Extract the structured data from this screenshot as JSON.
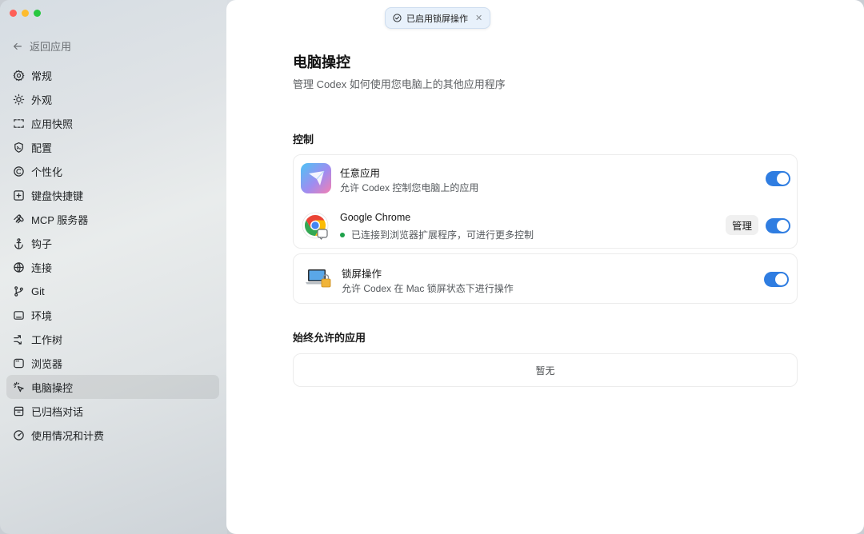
{
  "sidebar": {
    "back_label": "返回应用",
    "items": [
      {
        "label": "常规",
        "icon": "gear-icon"
      },
      {
        "label": "外观",
        "icon": "sun-icon"
      },
      {
        "label": "应用快照",
        "icon": "screenshot-icon"
      },
      {
        "label": "配置",
        "icon": "shield-icon"
      },
      {
        "label": "个性化",
        "icon": "smile-icon"
      },
      {
        "label": "键盘快捷键",
        "icon": "keyboard-icon"
      },
      {
        "label": "MCP 服务器",
        "icon": "mcp-icon"
      },
      {
        "label": "钩子",
        "icon": "anchor-icon"
      },
      {
        "label": "连接",
        "icon": "globe-icon"
      },
      {
        "label": "Git",
        "icon": "git-branch-icon"
      },
      {
        "label": "环境",
        "icon": "monitor-icon"
      },
      {
        "label": "工作树",
        "icon": "worktree-icon"
      },
      {
        "label": "浏览器",
        "icon": "browser-icon"
      },
      {
        "label": "电脑操控",
        "icon": "cursor-click-icon",
        "active": true
      },
      {
        "label": "已归档对话",
        "icon": "archive-icon"
      },
      {
        "label": "使用情况和计费",
        "icon": "gauge-icon"
      }
    ]
  },
  "toast": {
    "text": "已启用锁屏操作",
    "icon": "check-circle-icon"
  },
  "page": {
    "title": "电脑操控",
    "subtitle": "管理 Codex 如何使用您电脑上的其他应用程序"
  },
  "control_section": {
    "label": "控制",
    "items": [
      {
        "title": "任意应用",
        "desc": "允许 Codex 控制您电脑上的应用",
        "enabled": true,
        "icon": "paper-plane-app-icon"
      },
      {
        "title": "Google Chrome",
        "desc": "已连接到浏览器扩展程序，可进行更多控制",
        "enabled": true,
        "manage_label": "管理",
        "status": "connected",
        "icon": "chrome-icon"
      }
    ],
    "lock_item": {
      "title": "锁屏操作",
      "desc": "允许 Codex 在 Mac 锁屏状态下进行操作",
      "enabled": true,
      "icon": "laptop-lock-icon"
    }
  },
  "always_allowed": {
    "label": "始终允许的应用",
    "empty_text": "暂无"
  },
  "colors": {
    "accent": "#2f7de1",
    "connected_dot": "#1ea14a"
  }
}
